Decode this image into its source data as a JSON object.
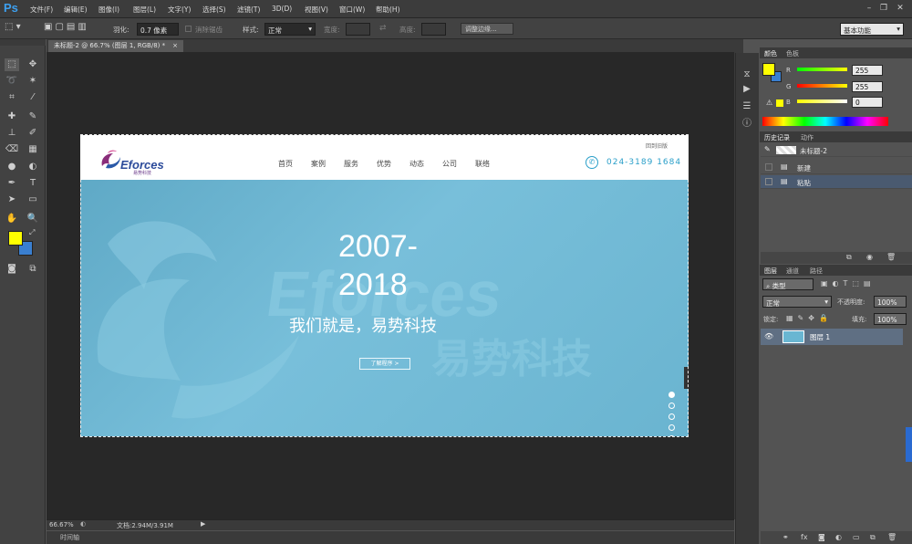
{
  "app": {
    "logo": "Ps"
  },
  "menu": [
    "文件(F)",
    "编辑(E)",
    "图像(I)",
    "图层(L)",
    "文字(Y)",
    "选择(S)",
    "滤镜(T)",
    "3D(D)",
    "视图(V)",
    "窗口(W)",
    "帮助(H)"
  ],
  "options": {
    "feather_label": "羽化:",
    "feather_value": "0.7 像素",
    "antialias_label": "消除锯齿",
    "style_label": "样式:",
    "style_value": "正常",
    "width_label": "宽度:",
    "height_label": "高度:",
    "refine_edge": "调整边缘...",
    "workspace": "基本功能"
  },
  "document": {
    "tab_title": "未标题-2 @ 66.7% (图层 1, RGB/8) *",
    "zoom": "66.67%",
    "doc_size": "文档:2.94M/3.91M",
    "timeline_label": "时间轴"
  },
  "site": {
    "brand": "Eforces",
    "brand_sub": "易势科技",
    "top_link": "回到旧版",
    "nav": [
      "首页",
      "案例",
      "服务",
      "优势",
      "动态",
      "公司",
      "联络"
    ],
    "phone": "024-3189 1684",
    "hero_year_1": "2007-",
    "hero_year_2": "2018",
    "hero_slogan": "我们就是，易势科技",
    "hero_button": "了解程序 >",
    "bg_text_1": "Eforces",
    "bg_text_2": "易势科技"
  },
  "color_panel": {
    "tabs": [
      "颜色",
      "色板"
    ],
    "r_label": "R",
    "r_value": "255",
    "g_label": "G",
    "g_value": "255",
    "b_label": "B",
    "b_value": "0",
    "foreground": "#ffff00",
    "background": "#3a7fd0"
  },
  "history_panel": {
    "tabs": [
      "历史记录",
      "动作"
    ],
    "snapshot": "未标题-2",
    "items": [
      "新建",
      "粘贴"
    ]
  },
  "layers_panel": {
    "tabs": [
      "图层",
      "通道",
      "路径"
    ],
    "filter_label": "类型",
    "blend_mode": "正常",
    "opacity_label": "不透明度:",
    "opacity_value": "100%",
    "lock_label": "锁定:",
    "fill_label": "填充:",
    "fill_value": "100%",
    "layer_name": "图层 1"
  }
}
